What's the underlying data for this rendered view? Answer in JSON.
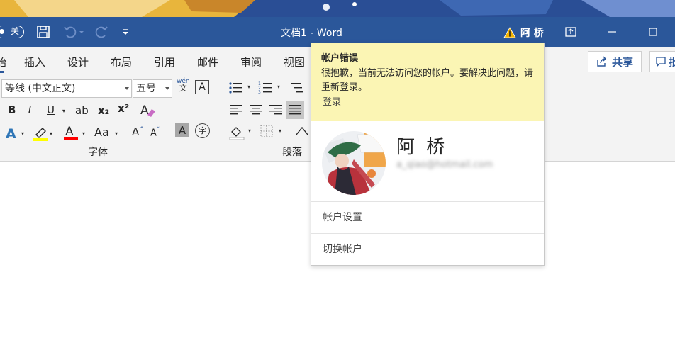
{
  "titlebar": {
    "autosave_label": "关",
    "document_title": "文档1  -  Word",
    "user_name": "阿 桥",
    "icons": [
      "save-icon",
      "undo-icon",
      "redo-icon",
      "customize-icon",
      "warning-icon",
      "ribbon-display-icon",
      "minimize-icon",
      "maximize-icon"
    ]
  },
  "tabs": [
    {
      "label": "始"
    },
    {
      "label": "插入"
    },
    {
      "label": "设计"
    },
    {
      "label": "布局"
    },
    {
      "label": "引用"
    },
    {
      "label": "邮件"
    },
    {
      "label": "审阅"
    },
    {
      "label": "视图"
    }
  ],
  "share": {
    "label": "共享"
  },
  "comment": {
    "label": "批"
  },
  "ribbon": {
    "font_name": "等线 (中文正文)",
    "font_size": "五号",
    "phonetic_top": "wén",
    "phonetic_bottom": "文",
    "char_border": "A",
    "bold": "B",
    "italic": "I",
    "underline": "U",
    "strike": "ab",
    "subscript": "x₂",
    "superscript": "x²",
    "grow_font": "A",
    "shrink_font": "A",
    "change_case": "Aa",
    "char_shading": "A",
    "enclose_char": "字",
    "font_group_label": "字体",
    "paragraph_group_label": "段落"
  },
  "account_popup": {
    "error_title": "帐户错误",
    "error_message": "很抱歉，当前无法访问您的帐户。要解决此问题，请重新登录。",
    "sign_in_link": "登录",
    "user_name": "阿 桥",
    "user_email": "a_qiao@hotmail.com",
    "menu": [
      {
        "label": "帐户设置"
      },
      {
        "label": "切换帐户"
      }
    ]
  },
  "colors": {
    "title_bar": "#2b579a",
    "error_panel": "#fbf5b4",
    "highlight_yellow": "#ffff00",
    "font_color_red": "#ff0000",
    "text_effect_blue": "#2e75b6"
  }
}
